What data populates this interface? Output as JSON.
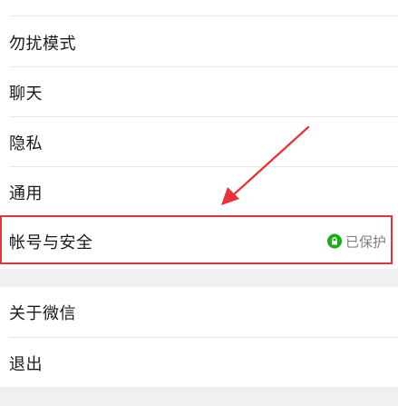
{
  "settings": {
    "group1": [
      {
        "label": "勿扰模式"
      },
      {
        "label": "聊天"
      },
      {
        "label": "隐私"
      },
      {
        "label": "通用"
      },
      {
        "label": "帐号与安全",
        "status": "已保护"
      }
    ],
    "group2": [
      {
        "label": "关于微信"
      },
      {
        "label": "退出"
      }
    ]
  },
  "colors": {
    "highlight": "#e8313a",
    "protected_badge": "#1aad19",
    "background": "#f0f0f0"
  },
  "icons": {
    "protected": "lock-icon",
    "annotation": "red-arrow-icon"
  }
}
